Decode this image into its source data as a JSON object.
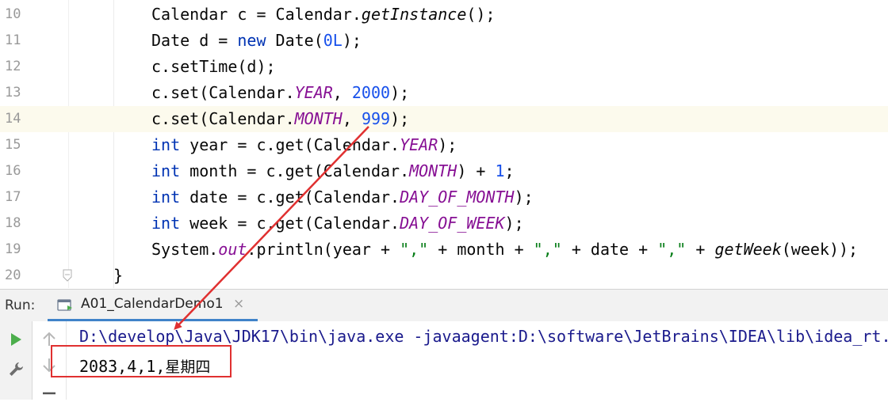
{
  "editor": {
    "lines": [
      {
        "num": "10",
        "indent": 191,
        "current": false,
        "tokens": [
          {
            "t": "Calendar c = Calendar.",
            "c": ""
          },
          {
            "t": "getInstance",
            "c": "method-i"
          },
          {
            "t": "();",
            "c": ""
          }
        ]
      },
      {
        "num": "11",
        "indent": 191,
        "current": false,
        "tokens": [
          {
            "t": "Date d = ",
            "c": ""
          },
          {
            "t": "new",
            "c": "kw"
          },
          {
            "t": " Date(",
            "c": ""
          },
          {
            "t": "0L",
            "c": "num"
          },
          {
            "t": ");",
            "c": ""
          }
        ]
      },
      {
        "num": "12",
        "indent": 191,
        "current": false,
        "tokens": [
          {
            "t": "c.setTime(d);",
            "c": ""
          }
        ]
      },
      {
        "num": "13",
        "indent": 191,
        "current": false,
        "tokens": [
          {
            "t": "c.set(Calendar.",
            "c": ""
          },
          {
            "t": "YEAR",
            "c": "static"
          },
          {
            "t": ", ",
            "c": ""
          },
          {
            "t": "2000",
            "c": "num"
          },
          {
            "t": ");",
            "c": ""
          }
        ]
      },
      {
        "num": "14",
        "indent": 191,
        "current": true,
        "tokens": [
          {
            "t": "c.set(Calendar.",
            "c": ""
          },
          {
            "t": "MONTH",
            "c": "static"
          },
          {
            "t": ", ",
            "c": ""
          },
          {
            "t": "999",
            "c": "num"
          },
          {
            "t": ");",
            "c": ""
          }
        ]
      },
      {
        "num": "15",
        "indent": 191,
        "current": false,
        "tokens": [
          {
            "t": "int",
            "c": "kw"
          },
          {
            "t": " year = c.get(Calendar.",
            "c": ""
          },
          {
            "t": "YEAR",
            "c": "static"
          },
          {
            "t": ");",
            "c": ""
          }
        ]
      },
      {
        "num": "16",
        "indent": 191,
        "current": false,
        "tokens": [
          {
            "t": "int",
            "c": "kw"
          },
          {
            "t": " month = c.get(Calendar.",
            "c": ""
          },
          {
            "t": "MONTH",
            "c": "static"
          },
          {
            "t": ") + ",
            "c": ""
          },
          {
            "t": "1",
            "c": "num"
          },
          {
            "t": ";",
            "c": ""
          }
        ]
      },
      {
        "num": "17",
        "indent": 191,
        "current": false,
        "tokens": [
          {
            "t": "int",
            "c": "kw"
          },
          {
            "t": " date = c.get(Calendar.",
            "c": ""
          },
          {
            "t": "DAY_OF_MONTH",
            "c": "static"
          },
          {
            "t": ");",
            "c": ""
          }
        ]
      },
      {
        "num": "18",
        "indent": 191,
        "current": false,
        "tokens": [
          {
            "t": "int",
            "c": "kw"
          },
          {
            "t": " week = c.get(Calendar.",
            "c": ""
          },
          {
            "t": "DAY_OF_WEEK",
            "c": "static"
          },
          {
            "t": ");",
            "c": ""
          }
        ]
      },
      {
        "num": "19",
        "indent": 191,
        "current": false,
        "tokens": [
          {
            "t": "System.",
            "c": ""
          },
          {
            "t": "out",
            "c": "static"
          },
          {
            "t": ".println(year + ",
            "c": ""
          },
          {
            "t": "\",\"",
            "c": "str"
          },
          {
            "t": " + month + ",
            "c": ""
          },
          {
            "t": "\",\"",
            "c": "str"
          },
          {
            "t": " + date + ",
            "c": ""
          },
          {
            "t": "\",\"",
            "c": "str"
          },
          {
            "t": " + ",
            "c": ""
          },
          {
            "t": "getWeek",
            "c": "method-i"
          },
          {
            "t": "(week));",
            "c": ""
          }
        ]
      },
      {
        "num": "20",
        "indent": 143,
        "current": false,
        "tokens": [
          {
            "t": "}",
            "c": ""
          }
        ]
      }
    ]
  },
  "run": {
    "label": "Run:",
    "tab_label": "A01_CalendarDemo1",
    "tab_close": "×",
    "command": "D:\\develop\\Java\\JDK17\\bin\\java.exe -javaagent:D:\\software\\JetBrains\\IDEA\\lib\\idea_rt.",
    "output_prefix": "2083,4,1,",
    "output_cjk": "星期四"
  },
  "colors": {
    "annotation": "#e03030",
    "run_icon": "#4cae4c",
    "tab_underline": "#4083c9"
  }
}
